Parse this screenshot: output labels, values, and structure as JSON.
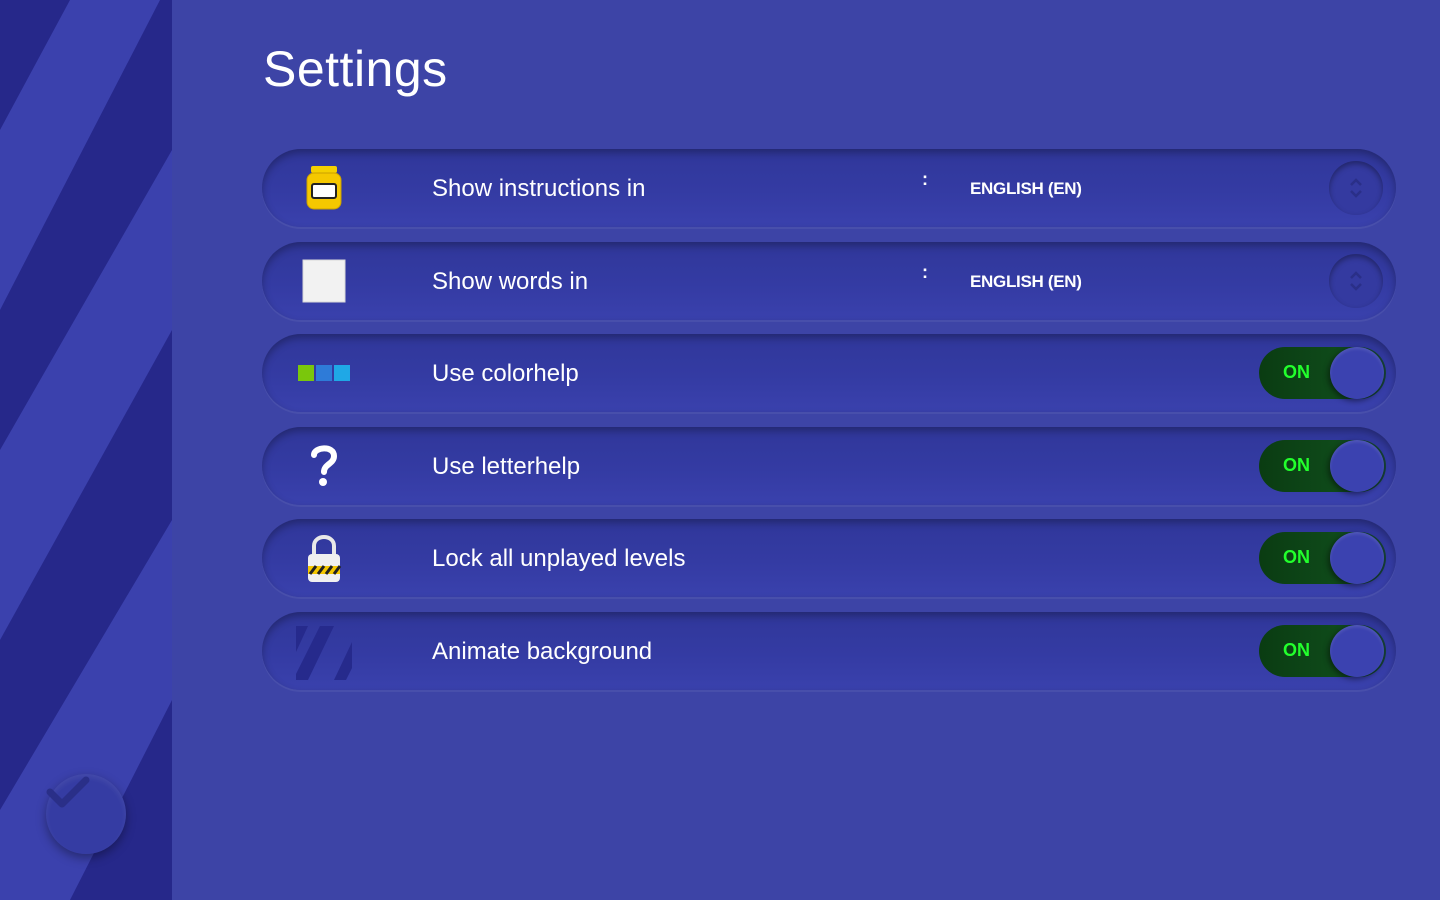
{
  "page": {
    "title": "Settings"
  },
  "colors": {
    "background": "#3d44a6",
    "row": "#343ba3",
    "toggle_on_text": "#22ff2c",
    "toggle_track": "#0f4a1a"
  },
  "settings": [
    {
      "icon": "instructions-jar-icon",
      "label": "Show instructions in",
      "type": "select",
      "value": "ENGLISH (EN)"
    },
    {
      "icon": "word-card-icon",
      "label": "Show words in",
      "type": "select",
      "value": "ENGLISH (EN)"
    },
    {
      "icon": "abc-color-blocks-icon",
      "label": "Use colorhelp",
      "type": "toggle",
      "state": "ON"
    },
    {
      "icon": "question-mark-icon",
      "label": "Use letterhelp",
      "type": "toggle",
      "state": "ON"
    },
    {
      "icon": "padlock-icon",
      "label": "Lock all unplayed levels",
      "type": "toggle",
      "state": "ON"
    },
    {
      "icon": "stripes-icon",
      "label": "Animate background",
      "type": "toggle",
      "state": "ON"
    }
  ],
  "icons": {
    "done": "checkmark-icon",
    "stepper": "up-down-arrows-icon"
  }
}
